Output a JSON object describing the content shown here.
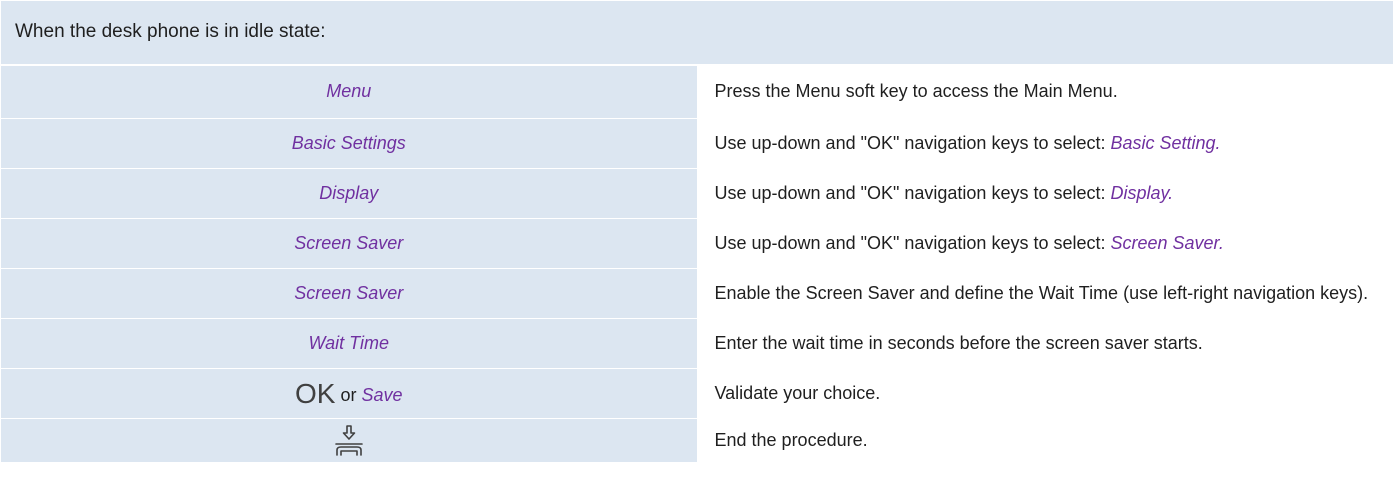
{
  "header": {
    "text": "When the desk phone is in idle state:"
  },
  "rows": [
    {
      "key": "Menu",
      "desc": "Press the Menu soft key to access the Main Menu."
    },
    {
      "key": "Basic Settings",
      "desc": "Use up-down and \"OK\" navigation keys to select: ",
      "desc_highlight": "Basic Setting."
    },
    {
      "key": "Display",
      "desc": "Use up-down and \"OK\" navigation keys to select: ",
      "desc_highlight": "Display."
    },
    {
      "key": "Screen Saver",
      "desc": "Use up-down and \"OK\" navigation keys to select: ",
      "desc_highlight": "Screen Saver."
    },
    {
      "key": "Screen Saver",
      "desc": "Enable the Screen Saver and define the Wait Time (use left-right navigation keys)."
    },
    {
      "key": "Wait Time",
      "desc": "Enter the wait time in seconds before the screen saver starts."
    },
    {
      "key_ok": "OK",
      "key_or": "or",
      "key_save": "Save",
      "desc": "Validate your choice."
    },
    {
      "key_icon": "hang-up-icon",
      "desc": "End the procedure."
    }
  ],
  "colors": {
    "key_cell_background": "#dce6f1",
    "key_text": "#7030a0",
    "body_text": "#1f1f1f"
  }
}
